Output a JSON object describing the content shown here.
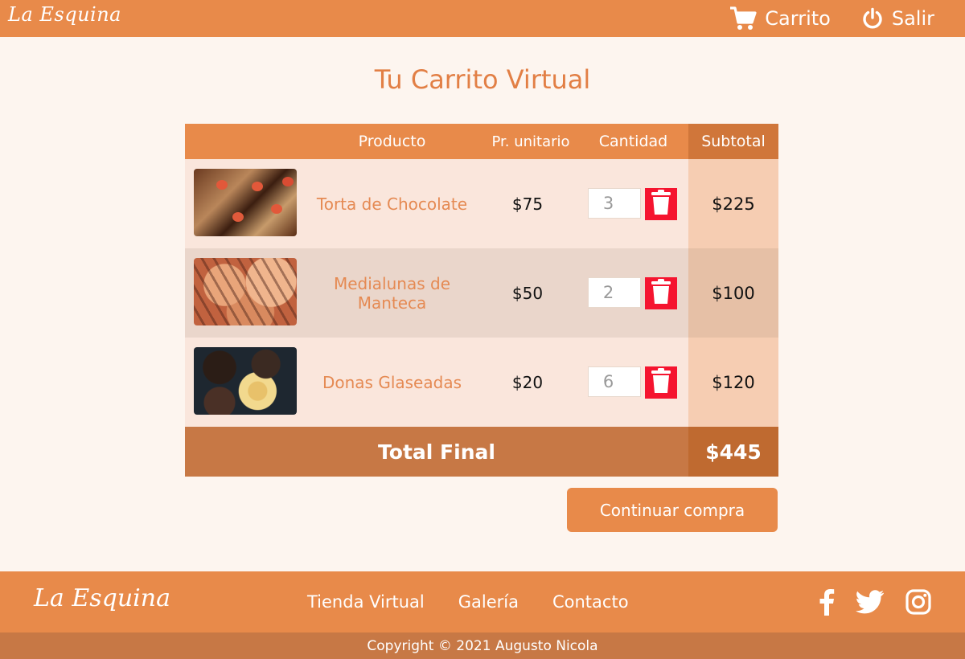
{
  "header": {
    "logo": "La Esquina",
    "nav": [
      {
        "label": "Carrito",
        "icon": "cart-icon"
      },
      {
        "label": "Salir",
        "icon": "power-icon"
      }
    ]
  },
  "page": {
    "title": "Tu Carrito Virtual"
  },
  "cart": {
    "columns": [
      "Producto",
      "Pr. unitario",
      "Cantidad",
      "Subtotal"
    ],
    "items": [
      {
        "name": "Torta de Chocolate",
        "unit_price": "$75",
        "quantity": "3",
        "subtotal": "$225",
        "image": "chocolate-cake-photo"
      },
      {
        "name": "Medialunas de Manteca",
        "unit_price": "$50",
        "quantity": "2",
        "subtotal": "$100",
        "image": "croissants-photo"
      },
      {
        "name": "Donas Glaseadas",
        "unit_price": "$20",
        "quantity": "6",
        "subtotal": "$120",
        "image": "donuts-photo"
      }
    ],
    "total_label": "Total Final",
    "total_value": "$445",
    "continue_label": "Continuar compra"
  },
  "footer": {
    "logo": "La Esquina",
    "links": [
      "Tienda Virtual",
      "Galería",
      "Contacto"
    ],
    "socials": [
      "facebook-icon",
      "twitter-icon",
      "instagram-icon"
    ],
    "copyright": "Copyright © 2021 Augusto Nicola"
  },
  "colors": {
    "primary": "#e88a4a",
    "dark": "#c77845",
    "background": "#fdf5ef",
    "delete": "#f5142f",
    "product_text": "#e58a53"
  }
}
